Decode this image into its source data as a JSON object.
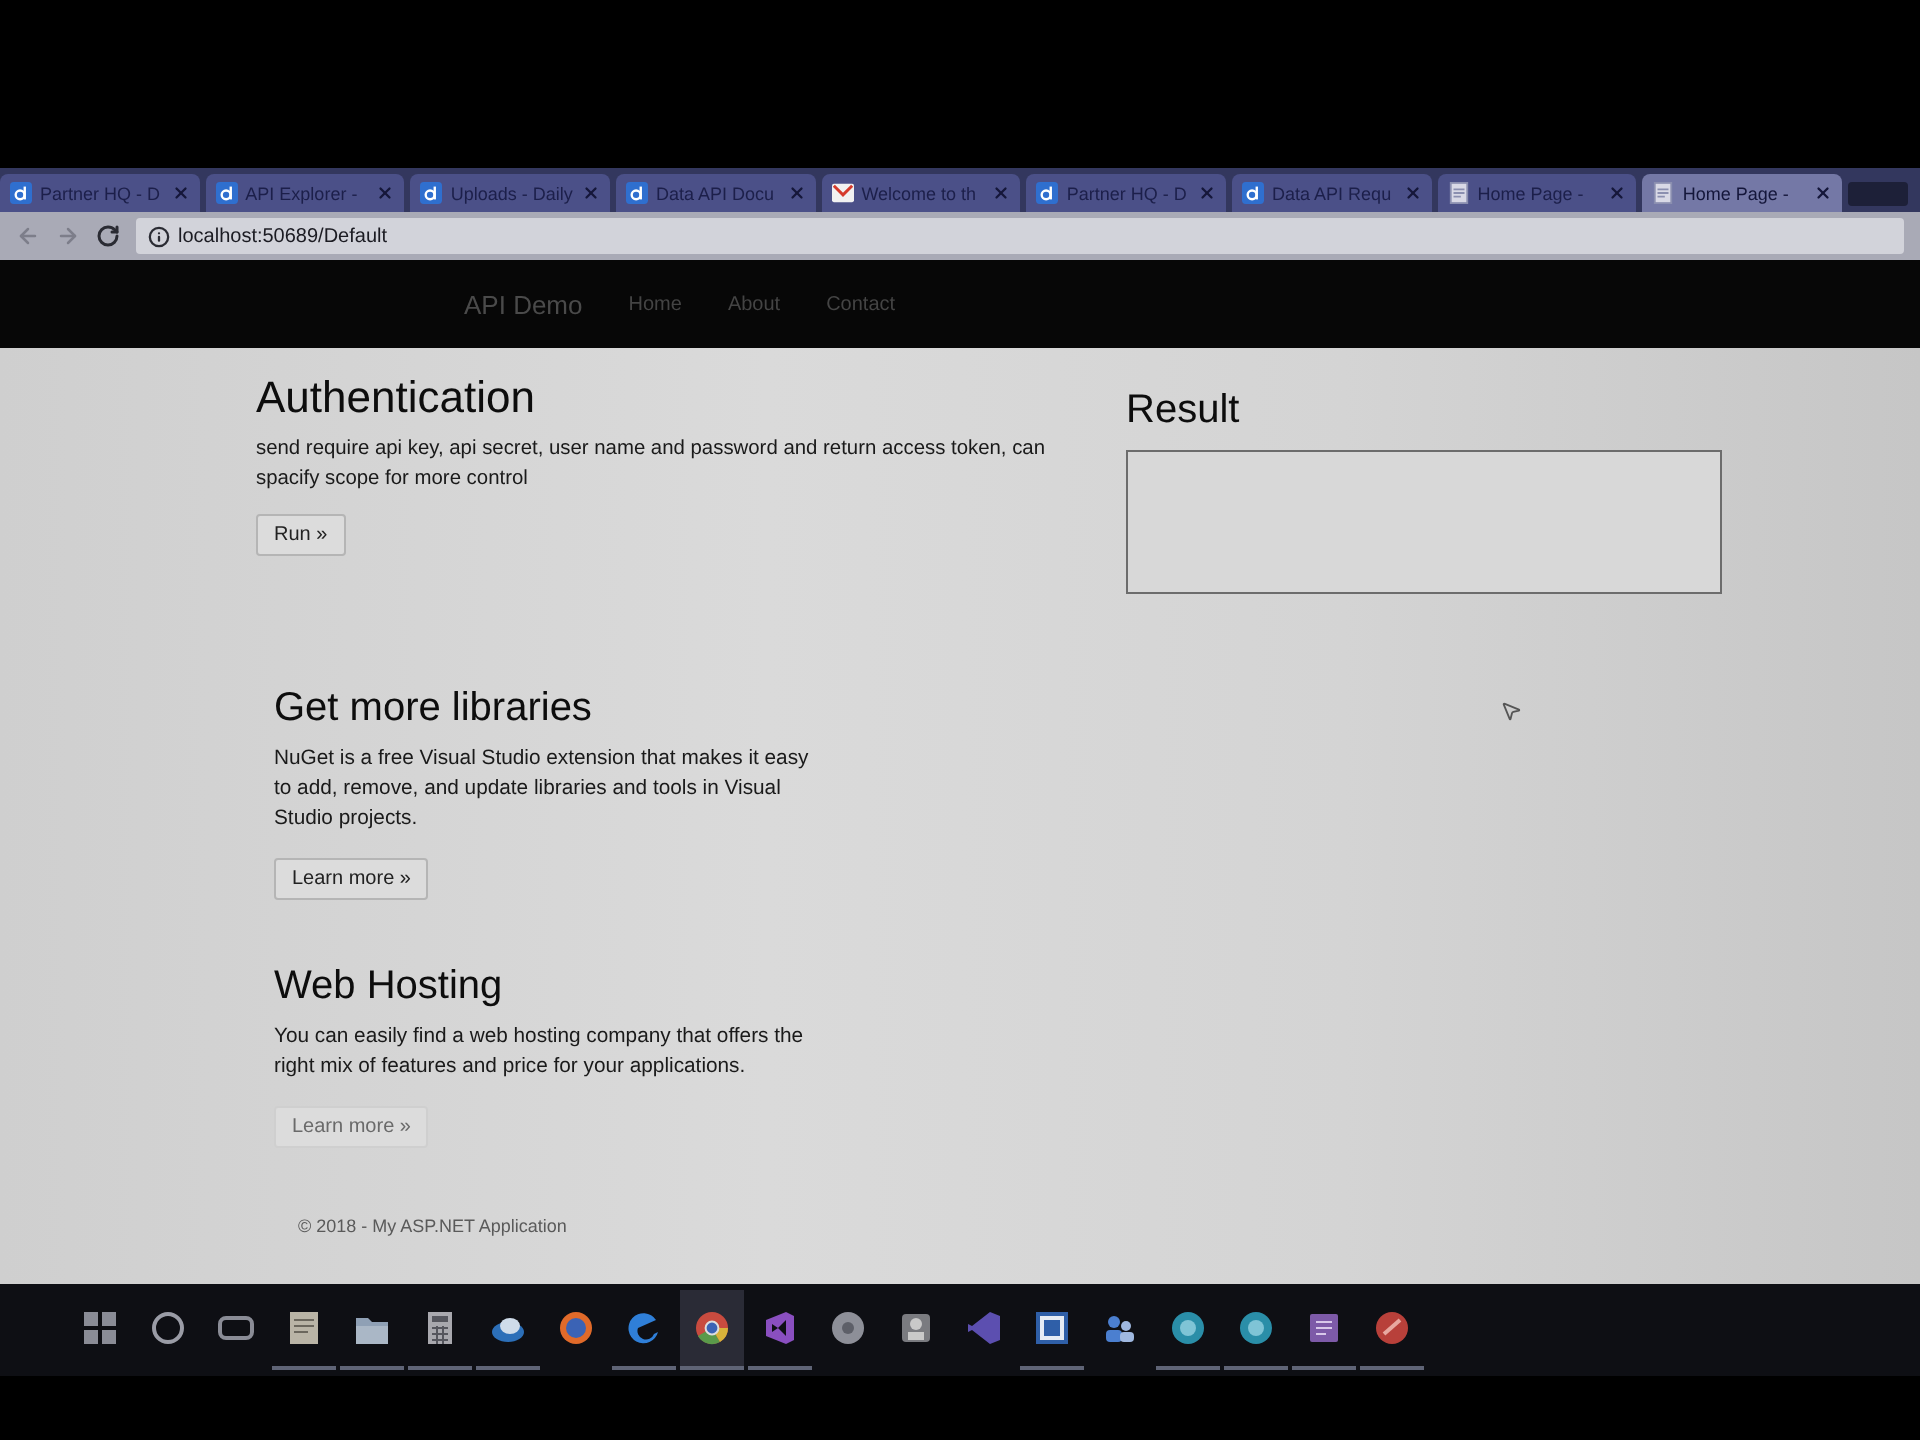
{
  "browser": {
    "tabs": [
      {
        "title": "Partner HQ - D",
        "kind": "favicon",
        "selected": false
      },
      {
        "title": "API Explorer - ",
        "kind": "favicon",
        "selected": false
      },
      {
        "title": "Uploads - Daily",
        "kind": "favicon",
        "selected": false
      },
      {
        "title": "Data API Docu",
        "kind": "favicon",
        "selected": false
      },
      {
        "title": "Welcome to th",
        "kind": "mail",
        "selected": false
      },
      {
        "title": "Partner HQ - D",
        "kind": "favicon",
        "selected": false
      },
      {
        "title": "Data API Requ",
        "kind": "favicon",
        "selected": false
      },
      {
        "title": "Home Page - ",
        "kind": "page",
        "selected": false
      },
      {
        "title": "Home Page - ",
        "kind": "page",
        "selected": true
      }
    ],
    "address": "localhost:50689/Default"
  },
  "navbar": {
    "brand": "API Demo",
    "links": [
      "Home",
      "About",
      "Contact"
    ]
  },
  "authentication": {
    "heading": "Authentication",
    "text": "send require api key, api secret, user name and password and return access token, can spacify scope for more control",
    "button": "Run »"
  },
  "result": {
    "heading": "Result"
  },
  "sections": [
    {
      "heading": "Get more libraries",
      "text": "NuGet is a free Visual Studio extension that makes it easy to add, remove, and update libraries and tools in Visual Studio projects.",
      "button": "Learn more »"
    },
    {
      "heading": "Web Hosting",
      "text": "You can easily find a web hosting company that offers the right mix of features and price for your applications.",
      "button": "Learn more »"
    }
  ],
  "footer": "© 2018 - My ASP.NET Application",
  "taskbar": [
    {
      "kind": "start",
      "running": false,
      "selected": false
    },
    {
      "kind": "search",
      "running": false,
      "selected": false
    },
    {
      "kind": "taskview",
      "running": false,
      "selected": false
    },
    {
      "kind": "document",
      "running": true,
      "selected": false
    },
    {
      "kind": "folder",
      "running": true,
      "selected": false
    },
    {
      "kind": "calculator",
      "running": true,
      "selected": false
    },
    {
      "kind": "cloud",
      "running": true,
      "selected": false
    },
    {
      "kind": "orb",
      "running": false,
      "selected": false
    },
    {
      "kind": "edge",
      "running": true,
      "selected": false
    },
    {
      "kind": "chrome",
      "running": true,
      "selected": true
    },
    {
      "kind": "studio",
      "running": true,
      "selected": false
    },
    {
      "kind": "disc",
      "running": false,
      "selected": false
    },
    {
      "kind": "app",
      "running": false,
      "selected": false
    },
    {
      "kind": "code",
      "running": false,
      "selected": false
    },
    {
      "kind": "tile",
      "running": true,
      "selected": false
    },
    {
      "kind": "people",
      "running": false,
      "selected": false
    },
    {
      "kind": "chat",
      "running": true,
      "selected": false
    },
    {
      "kind": "chat",
      "running": true,
      "selected": false
    },
    {
      "kind": "note",
      "running": true,
      "selected": false
    },
    {
      "kind": "slash",
      "running": true,
      "selected": false
    }
  ]
}
